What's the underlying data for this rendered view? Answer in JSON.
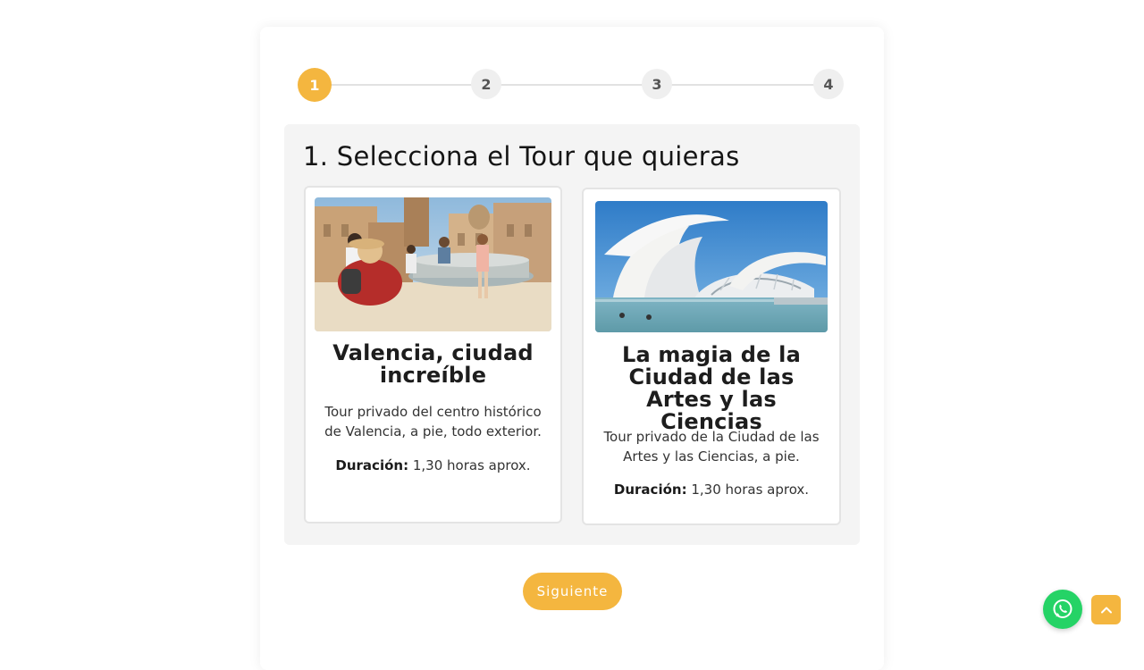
{
  "stepper": {
    "steps": [
      {
        "label": "1",
        "active": true
      },
      {
        "label": "2",
        "active": false
      },
      {
        "label": "3",
        "active": false
      },
      {
        "label": "4",
        "active": false
      }
    ]
  },
  "section": {
    "title": "1. Selecciona el Tour que quieras"
  },
  "tours": [
    {
      "image_icon": "valencia-plaza-photo",
      "title": "Valencia, ciudad increíble",
      "description": "Tour privado del centro histórico de Valencia, a pie, todo exterior.",
      "duration_label": "Duración:",
      "duration_value": "1,30 horas aprox."
    },
    {
      "image_icon": "ciudad-artes-ciencias-photo",
      "title": "La magia de la Ciudad de las Artes y las Ciencias",
      "description": "Tour privado de la Ciudad de las Artes y las Ciencias, a pie.",
      "duration_label": "Duración:",
      "duration_value": "1,30 horas aprox."
    }
  ],
  "actions": {
    "next_label": "Siguiente"
  },
  "floating": {
    "whatsapp_icon": "whatsapp-icon",
    "back_to_top_icon": "chevron-up-icon"
  },
  "colors": {
    "accent": "#f4b63f",
    "whatsapp": "#25d366",
    "panel_bg": "#f4f4f4"
  }
}
